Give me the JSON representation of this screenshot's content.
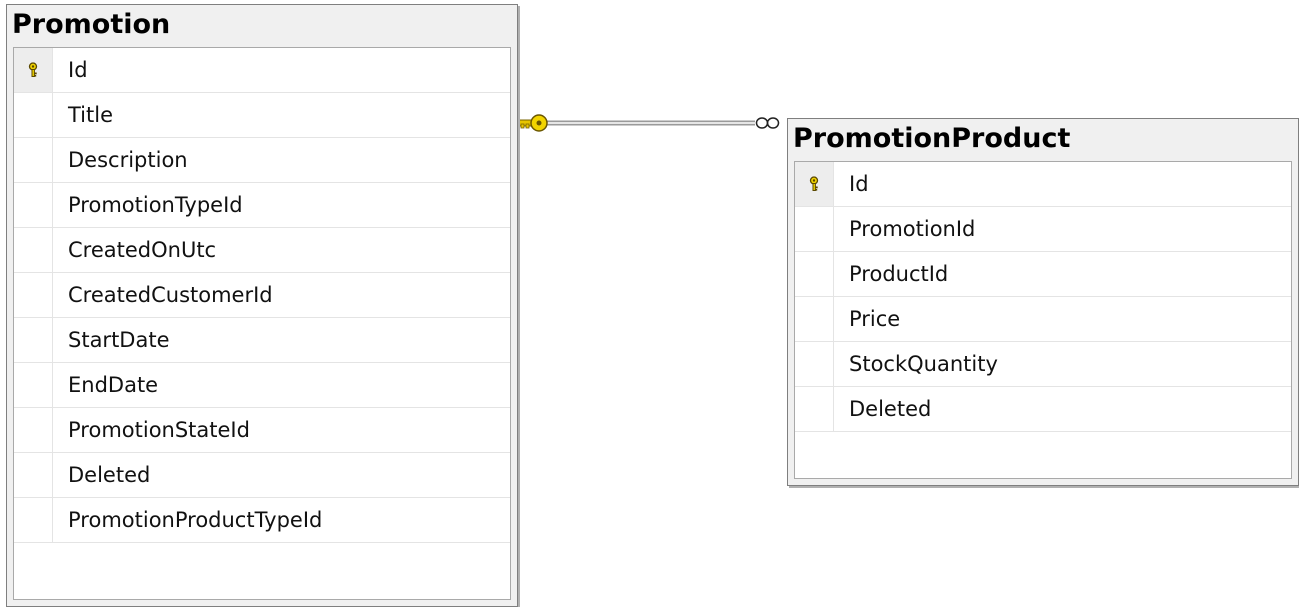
{
  "colors": {
    "key_icon": "#e8c500",
    "connector": "#999999",
    "table_frame": "#f0f0f0"
  },
  "relationship": {
    "from_end": "key-icon",
    "to_end": "infinity-icon"
  },
  "tables": [
    {
      "name": "Promotion",
      "fields": [
        {
          "name": "Id",
          "primary_key": true
        },
        {
          "name": "Title",
          "primary_key": false
        },
        {
          "name": "Description",
          "primary_key": false
        },
        {
          "name": "PromotionTypeId",
          "primary_key": false
        },
        {
          "name": "CreatedOnUtc",
          "primary_key": false
        },
        {
          "name": "CreatedCustomerId",
          "primary_key": false
        },
        {
          "name": "StartDate",
          "primary_key": false
        },
        {
          "name": "EndDate",
          "primary_key": false
        },
        {
          "name": "PromotionStateId",
          "primary_key": false
        },
        {
          "name": "Deleted",
          "primary_key": false
        },
        {
          "name": "PromotionProductTypeId",
          "primary_key": false
        }
      ]
    },
    {
      "name": "PromotionProduct",
      "fields": [
        {
          "name": "Id",
          "primary_key": true
        },
        {
          "name": "PromotionId",
          "primary_key": false
        },
        {
          "name": "ProductId",
          "primary_key": false
        },
        {
          "name": "Price",
          "primary_key": false
        },
        {
          "name": "StockQuantity",
          "primary_key": false
        },
        {
          "name": "Deleted",
          "primary_key": false
        }
      ]
    }
  ]
}
